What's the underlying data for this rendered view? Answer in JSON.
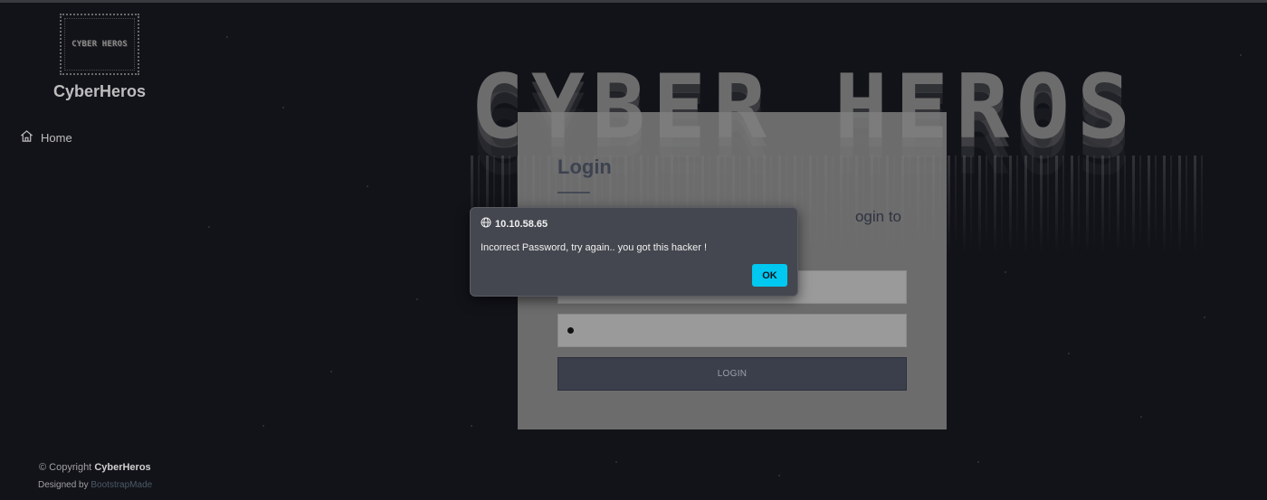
{
  "sidebar": {
    "logo_text": "CYBER HEROS",
    "brand": "CyberHeros",
    "nav": [
      {
        "label": "Home",
        "icon": "home-icon"
      }
    ],
    "footer": {
      "copyright_prefix": "© Copyright",
      "copyright_brand": "CyberHeros",
      "designed_by": "Designed by",
      "designer": "BootstrapMade"
    }
  },
  "banner": {
    "text": "CYBER HEROS"
  },
  "login": {
    "title": "Login",
    "subtitle_visible": "ogin to",
    "username_value": "",
    "password_mask": "•",
    "button_label": "LOGIN"
  },
  "alert": {
    "origin": "10.10.58.65",
    "message": "Incorrect Password, try again.. you got this hacker !",
    "ok_label": "OK",
    "accent": "#00c8f0"
  },
  "colors": {
    "background": "#121319",
    "card": "#808080",
    "dialog": "#44474f"
  }
}
